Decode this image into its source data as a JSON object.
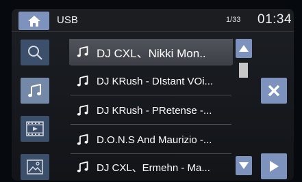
{
  "header": {
    "home_icon": "home-icon",
    "source": "USB",
    "track_index": "1/33",
    "time": "01:34"
  },
  "sidebar": {
    "items": [
      {
        "name": "search",
        "icon": "search-icon"
      },
      {
        "name": "music",
        "icon": "music-note-icon",
        "active": true
      },
      {
        "name": "video",
        "icon": "film-icon"
      },
      {
        "name": "photo",
        "icon": "image-icon"
      }
    ]
  },
  "playlist": {
    "items": [
      {
        "title": "DJ CXL、Nikki Mon..",
        "selected": true
      },
      {
        "title": "DJ KRush - DIstant VOi..."
      },
      {
        "title": "DJ KRush - PRetense -..."
      },
      {
        "title": "D.O.N.S And Maurizio -..."
      },
      {
        "title": "DJ CXL、Ermehn - Ma..."
      }
    ]
  },
  "scrollbar": {
    "up_icon": "triangle-up-icon",
    "down_icon": "triangle-down-icon"
  },
  "actions": {
    "close_icon": "close-icon",
    "play_icon": "play-icon"
  },
  "colors": {
    "accent": "#7d93bd",
    "sidebar_button": "#3c506c",
    "background": "#121418"
  }
}
